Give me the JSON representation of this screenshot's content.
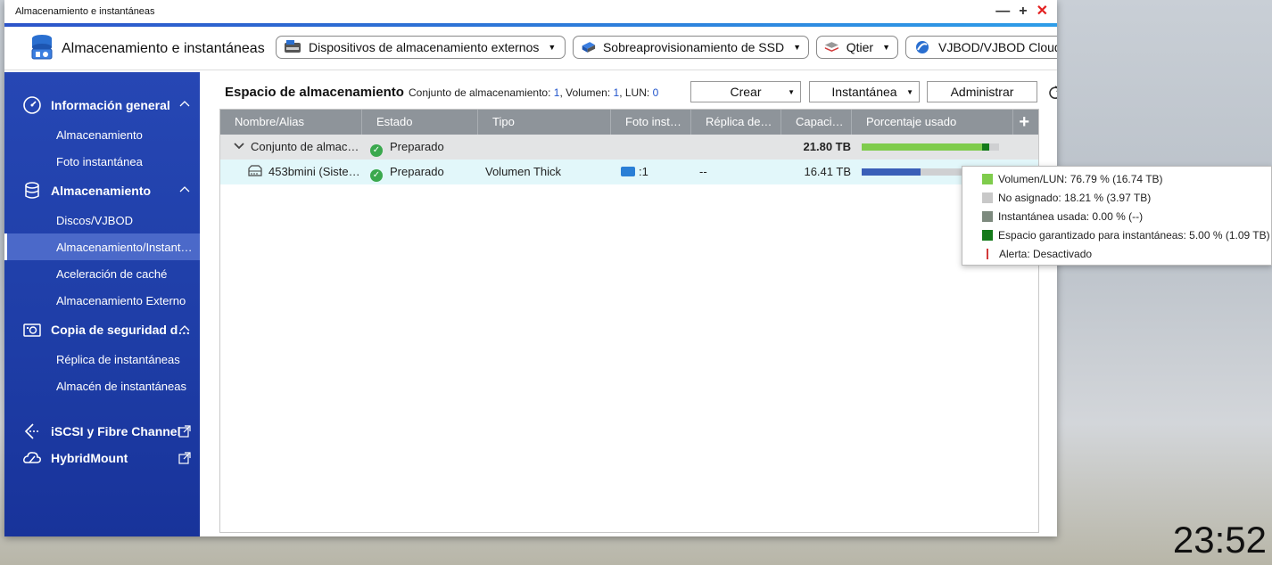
{
  "window": {
    "title": "Almacenamiento e instantáneas"
  },
  "toolbar": {
    "app_title": "Almacenamiento e instantáneas",
    "dropdowns": [
      {
        "label": "Dispositivos de almacenamiento externos",
        "icon": "raid-enclosure-icon"
      },
      {
        "label": "Sobreaprovisionamiento de SSD",
        "icon": "ssd-icon"
      },
      {
        "label": "Qtier",
        "icon": "qtier-layers-icon"
      },
      {
        "label": "VJBOD/VJBOD Cloud",
        "icon": "vjbod-cloud-icon"
      }
    ]
  },
  "sidebar": {
    "sections": [
      {
        "label": "Información general",
        "icon": "dashboard-gauge-icon",
        "items": [
          "Almacenamiento",
          "Foto instantánea"
        ]
      },
      {
        "label": "Almacenamiento",
        "icon": "database-icon",
        "items": [
          "Discos/VJBOD",
          "Almacenamiento/Instant…",
          "Aceleración de caché",
          "Almacenamiento Externo"
        ]
      },
      {
        "label": "Copia de seguridad d…",
        "icon": "camera-backup-icon",
        "items": [
          "Réplica de instantáneas",
          "Almacén de instantáneas"
        ]
      }
    ],
    "links": [
      {
        "label": "iSCSI y Fibre Channel",
        "icon": "iscsi-icon"
      },
      {
        "label": "HybridMount",
        "icon": "cloud-mount-icon"
      }
    ]
  },
  "main": {
    "title": "Espacio de almacenamiento",
    "summary": {
      "pool_label": "Conjunto de almacenamiento:",
      "pool_count": "1",
      "volume_label": ", Volumen:",
      "volume_count": "1",
      "lun_label": ", LUN:",
      "lun_count": "0"
    },
    "buttons": {
      "create": "Crear",
      "snapshot": "Instantánea",
      "manage": "Administrar"
    },
    "columns": [
      "Nombre/Alias",
      "Estado",
      "Tipo",
      "Foto inst…",
      "Réplica de…",
      "Capaci…",
      "Porcentaje usado"
    ],
    "rows": [
      {
        "name": "Conjunto de almac…",
        "status": "Preparado",
        "type": "",
        "snapshot": "",
        "replica": "",
        "capacity": "21.80 TB",
        "usage": {
          "used": 0.9279,
          "snapshot_reserved": 0.05,
          "unallocated": 0.0721
        }
      },
      {
        "name": "453bmini (Siste…",
        "status": "Preparado",
        "type": "Volumen Thick",
        "snapshot": ":1",
        "replica": "--",
        "capacity": "16.41 TB",
        "usage": {
          "used": 0.43
        }
      }
    ]
  },
  "tooltip": {
    "items": [
      {
        "label": "Volumen/LUN: 76.79 % (16.74 TB)",
        "color": "#7fcc4c"
      },
      {
        "label": "No asignado: 18.21 % (3.97 TB)",
        "color": "#c8c8c8"
      },
      {
        "label": "Instantánea usada: 0.00 % (--)",
        "color": "#7d8a7e"
      },
      {
        "label": "Espacio garantizado para instantáneas: 5.00 % (1.09 TB)",
        "color": "#147a1a"
      }
    ],
    "alert": "Alerta: Desactivado"
  },
  "colors": {
    "sidebar_bg": "#2245b0",
    "accent": "#2e9de8",
    "bar_used_pool": "#7fcc4c",
    "bar_used_volume": "#3a5fb8"
  },
  "clock": "23:52"
}
